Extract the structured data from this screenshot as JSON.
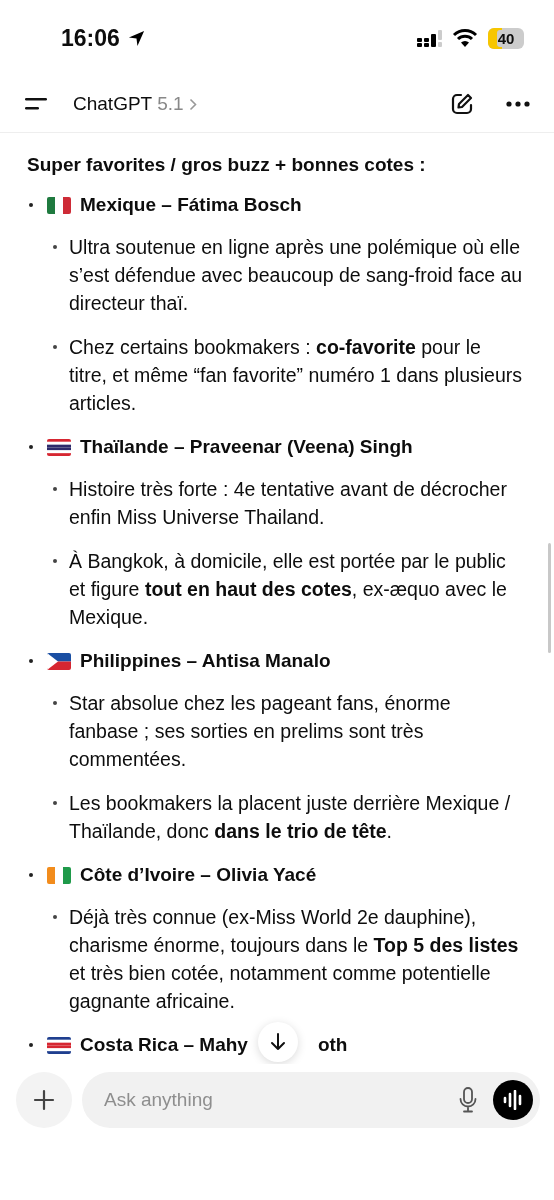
{
  "status_bar": {
    "time": "16:06",
    "battery": "40"
  },
  "header": {
    "title": "ChatGPT",
    "version": "5.1"
  },
  "section_title": "Super favorites / gros buzz + bonnes cotes :",
  "items": [
    {
      "kind": "mx",
      "heading": "Mexique – Fátima Bosch",
      "points": [
        "Ultra soutenue en ligne après une polémique où elle s’est défendue avec beaucoup de sang-froid face au directeur thaï.",
        "Chez certains bookmakers : **co-favorite** pour le titre, et même “fan favorite” numéro 1 dans plusieurs articles."
      ]
    },
    {
      "kind": "th",
      "heading": "Thaïlande – Praveenar (Veena) Singh",
      "points": [
        "Histoire très forte : 4e tentative avant de décrocher enfin Miss Universe Thailand.",
        "À Bangkok, à domicile, elle est portée par le public et figure **tout en haut des cotes**, ex-æquo avec le Mexique."
      ]
    },
    {
      "kind": "ph",
      "heading": "Philippines – Ahtisa Manalo",
      "points": [
        "Star absolue chez les pageant fans, énorme fanbase ; ses sorties en prelims sont très commentées.",
        "Les bookmakers la placent juste derrière Mexique / Thaïlande, donc **dans le trio de tête**."
      ]
    },
    {
      "kind": "ci",
      "heading": "Côte d’Ivoire – Olivia Yacé",
      "points": [
        "Déjà très connue (ex-Miss World 2e dauphine), charisme énorme, toujours dans le **Top 5 des listes** et très bien cotée, notamment comme potentielle gagnante africaine."
      ]
    },
    {
      "kind": "cr",
      "heading": "Costa Rica – Mahy",
      "heading_tail": "oth"
    }
  ],
  "composer": {
    "placeholder": "Ask anything"
  }
}
